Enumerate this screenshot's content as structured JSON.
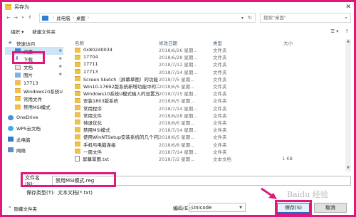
{
  "window": {
    "title": "另存为",
    "close": "✕"
  },
  "address": {
    "back": "←",
    "forward": "→",
    "up_arrow": "↑",
    "path": [
      "此电脑",
      "桌面"
    ],
    "separator": "›",
    "search_placeholder": "搜索\"桌面\""
  },
  "toolbar": {
    "organize": "组织 ▾",
    "new_folder": "新建文件夹"
  },
  "sidebar": {
    "items": [
      {
        "label": "快速访问",
        "icon": "star-icon"
      },
      {
        "label": "桌面",
        "icon": "desktop-icon",
        "selected": true,
        "pinned": true
      },
      {
        "label": "下载",
        "icon": "download-icon",
        "pinned": true
      },
      {
        "label": "文档",
        "icon": "documents-icon",
        "pinned": true
      },
      {
        "label": "图片",
        "icon": "pictures-icon",
        "pinned": true
      },
      {
        "label": "17713",
        "icon": "folder-icon"
      },
      {
        "label": "Windows10系统U",
        "icon": "folder-icon"
      },
      {
        "label": "常用文件",
        "icon": "folder-icon"
      },
      {
        "label": "禁用MSI模式",
        "icon": "folder-icon"
      },
      {
        "label": "OneDrive",
        "icon": "onedrive-icon"
      },
      {
        "label": "WPS云文档",
        "icon": "cloud-icon"
      },
      {
        "label": "此电脑",
        "icon": "computer-icon"
      },
      {
        "label": "网络",
        "icon": "network-icon"
      }
    ]
  },
  "files": {
    "headers": {
      "name": "名称",
      "date": "修改日期",
      "type": "类型",
      "size": "大小"
    },
    "rows": [
      {
        "name": "0x80240034",
        "date": "2018/6/26 星期...",
        "type": "文件夹",
        "size": "",
        "icon": "folder"
      },
      {
        "name": "17704",
        "date": "2018/6/28 星期...",
        "type": "文件夹",
        "size": "",
        "icon": "folder"
      },
      {
        "name": "17711",
        "date": "2018/7/12 星期...",
        "type": "文件夹",
        "size": "",
        "icon": "folder"
      },
      {
        "name": "17713",
        "date": "2018/7/14 星期...",
        "type": "文件夹",
        "size": "",
        "icon": "folder"
      },
      {
        "name": "Screen Sketch（屏幕草图）的功能",
        "date": "2018/7/5 星期...",
        "type": "文件夹",
        "size": "",
        "icon": "folder"
      },
      {
        "name": "Win10-17692版系统新增功能中的二项...",
        "date": "2018/6/5 星期...",
        "type": "文件夹",
        "size": "",
        "icon": "folder"
      },
      {
        "name": "Windows10系统U模式输入的设置方法...",
        "date": "2018/7/15 星期...",
        "type": "文件夹",
        "size": "",
        "icon": "folder"
      },
      {
        "name": "安装1803版系统",
        "date": "2018/6/5 星期...",
        "type": "文件夹",
        "size": "",
        "icon": "folder"
      },
      {
        "name": "常用程序",
        "date": "2018/7/14 星期...",
        "type": "文件夹",
        "size": "",
        "icon": "folder"
      },
      {
        "name": "常用文件",
        "date": "2018/6/28 星期...",
        "type": "文件夹",
        "size": "",
        "icon": "folder"
      },
      {
        "name": "待退优化",
        "date": "2018/6/6 星期...",
        "type": "文件夹",
        "size": "",
        "icon": "folder"
      },
      {
        "name": "禁用MSI模式",
        "date": "2018/7/14 星期...",
        "type": "文件夹",
        "size": "",
        "icon": "folder"
      },
      {
        "name": "使用WinNTSetup安装系统的几个问题",
        "date": "2018/6/5 星期...",
        "type": "文件夹",
        "size": "",
        "icon": "folder"
      },
      {
        "name": "手机与电脑连接",
        "date": "2018/6/8 星期...",
        "type": "文件夹",
        "size": "",
        "icon": "folder"
      },
      {
        "name": "一周文件",
        "date": "2018/7/14 星期...",
        "type": "文件夹",
        "size": "",
        "icon": "folder"
      },
      {
        "name": "屏幕草图.txt",
        "date": "2018/7/2 星期...",
        "type": "文本文档",
        "size": "1 KB",
        "icon": "txt"
      }
    ]
  },
  "save_form": {
    "filename_label": "文件名(N):",
    "filename_value": "禁用MSI模式.reg",
    "filetype_label": "保存类型(T):",
    "filetype_value": "文本文档(*.txt)",
    "hide_folders": "隐藏文件夹",
    "encoding_label": "编码(E):",
    "encoding_value": "Unicode",
    "save_label": "保存(S)",
    "cancel_label": "取消"
  },
  "watermark": "Baidu 经验",
  "colors": {
    "highlight": "#e0187a",
    "folder": "#f1c04b",
    "accent": "#0078d7"
  }
}
